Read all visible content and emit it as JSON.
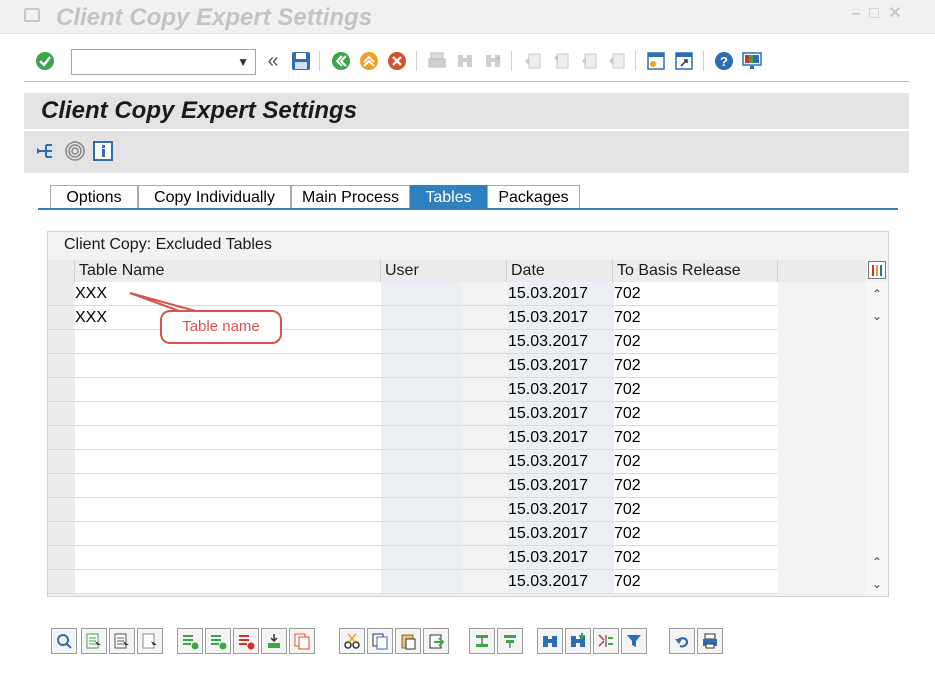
{
  "window": {
    "title": "Client Copy Expert Settings"
  },
  "toolbar": {
    "command_value": "",
    "back_glyph": "«"
  },
  "screen": {
    "title": "Client Copy Expert Settings"
  },
  "tabs": [
    {
      "label": "Options",
      "active": false
    },
    {
      "label": "Copy Individually",
      "active": false
    },
    {
      "label": "Main Process",
      "active": false
    },
    {
      "label": "Tables",
      "active": true
    },
    {
      "label": "Packages",
      "active": false
    }
  ],
  "table": {
    "caption": "Client Copy: Excluded Tables",
    "columns": [
      "Table Name",
      "User",
      "Date",
      "To Basis Release"
    ],
    "rows": [
      {
        "name": "XXX",
        "user": "",
        "date": "15.03.2017",
        "release": "702"
      },
      {
        "name": "XXX",
        "user": "",
        "date": "15.03.2017",
        "release": "702"
      },
      {
        "name": "",
        "user": "",
        "date": "15.03.2017",
        "release": "702"
      },
      {
        "name": "",
        "user": "",
        "date": "15.03.2017",
        "release": "702"
      },
      {
        "name": "",
        "user": "",
        "date": "15.03.2017",
        "release": "702"
      },
      {
        "name": "",
        "user": "",
        "date": "15.03.2017",
        "release": "702"
      },
      {
        "name": "",
        "user": "",
        "date": "15.03.2017",
        "release": "702"
      },
      {
        "name": "",
        "user": "",
        "date": "15.03.2017",
        "release": "702"
      },
      {
        "name": "",
        "user": "",
        "date": "15.03.2017",
        "release": "702"
      },
      {
        "name": "",
        "user": "",
        "date": "15.03.2017",
        "release": "702"
      },
      {
        "name": "",
        "user": "",
        "date": "15.03.2017",
        "release": "702"
      },
      {
        "name": "",
        "user": "",
        "date": "15.03.2017",
        "release": "702"
      },
      {
        "name": "",
        "user": "",
        "date": "15.03.2017",
        "release": "702"
      }
    ]
  },
  "callout": {
    "text": "Table name"
  },
  "colors": {
    "accent": "#2f80c0",
    "callout": "#d9534f",
    "header_bg": "#e3e3e3"
  }
}
